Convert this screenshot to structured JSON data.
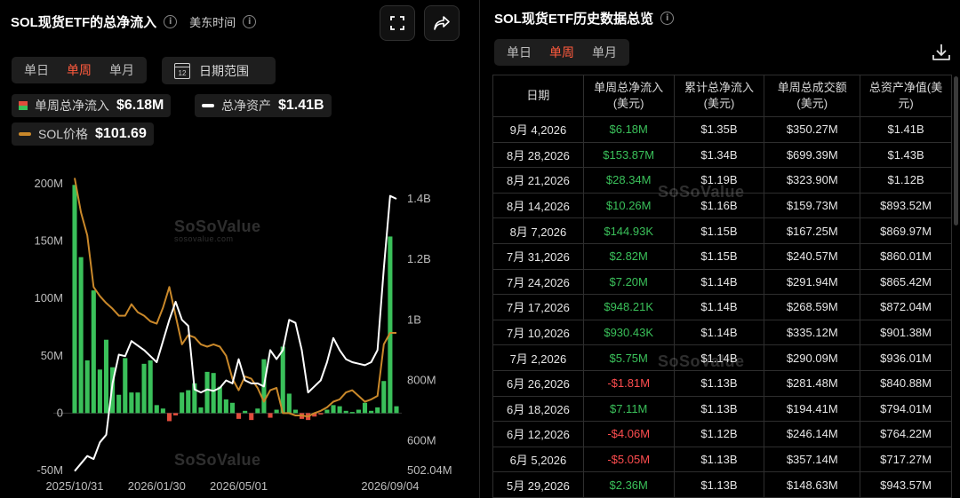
{
  "left": {
    "title": "SOL现货ETF的总净流入",
    "timezone": "美东时间",
    "period_tabs": [
      "单日",
      "单周",
      "单月"
    ],
    "active_tab": "单周",
    "date_range_label": "日期范围",
    "calendar_day": "12",
    "stats": {
      "net_inflow_label": "单周总净流入",
      "net_inflow_value": "$6.18M",
      "total_assets_label": "总净资产",
      "total_assets_value": "$1.41B",
      "price_label": "SOL价格",
      "price_value": "$101.69"
    },
    "watermark": "SoSoValue",
    "watermark_sub": "sosovalue.com"
  },
  "colors": {
    "inflow": "#3ac05a",
    "outflow": "#e04c3c",
    "net_assets_line": "#ffffff",
    "price_line": "#c9882a",
    "accent": "#ff5a3d"
  },
  "chart_data": {
    "type": "bar",
    "x_ticks": [
      "2025/10/31",
      "2026/01/30",
      "2026/05/01",
      "2026/09/04"
    ],
    "y_left_ticks": [
      "200M",
      "150M",
      "100M",
      "50M",
      "0",
      "-50M"
    ],
    "y_right_ticks": [
      "1.4B",
      "1.2B",
      "1B",
      "800M",
      "600M",
      "502.04M"
    ],
    "ylim_left": [
      -50,
      200
    ],
    "ylim_right": [
      502.04,
      1450
    ],
    "series": [
      {
        "name": "单周总净流入",
        "unit": "M",
        "values": [
          199,
          136,
          46,
          107,
          38,
          64,
          40,
          16,
          48,
          18,
          18,
          43,
          46,
          7,
          4,
          -7,
          -2,
          18,
          20,
          26,
          5,
          36,
          35,
          23,
          12,
          9,
          -5,
          2,
          -6,
          4,
          47,
          -4,
          3,
          58,
          17,
          3,
          -5,
          -6,
          -3,
          -1,
          3,
          7,
          6,
          2,
          1,
          3,
          9,
          2,
          5,
          28,
          154,
          6
        ]
      },
      {
        "name": "总净资产",
        "unit": "M",
        "values": [
          500,
          525,
          550,
          540,
          595,
          620,
          790,
          885,
          880,
          930,
          915,
          900,
          880,
          860,
          930,
          1000,
          1060,
          1000,
          980,
          770,
          760,
          770,
          765,
          775,
          800,
          790,
          870,
          800,
          790,
          790,
          780,
          900,
          870,
          900,
          1000,
          990,
          900,
          760,
          780,
          800,
          860,
          940,
          900,
          870,
          860,
          855,
          850,
          860,
          900,
          1170,
          1410,
          1400
        ]
      },
      {
        "name": "SOL价格",
        "unit": "USD",
        "values": [
          205,
          175,
          155,
          110,
          102,
          96,
          91,
          85,
          85,
          95,
          88,
          85,
          80,
          78,
          92,
          110,
          85,
          60,
          68,
          66,
          60,
          58,
          60,
          58,
          50,
          30,
          20,
          32,
          30,
          22,
          10,
          20,
          22,
          0,
          0,
          -2,
          -2,
          -3,
          0,
          2,
          5,
          10,
          12,
          18,
          20,
          15,
          10,
          12,
          15,
          60,
          70,
          70
        ]
      }
    ]
  },
  "right": {
    "title": "SOL现货ETF历史数据总览",
    "period_tabs": [
      "单日",
      "单周",
      "单月"
    ],
    "active_tab": "单周",
    "headers": [
      [
        "日期",
        ""
      ],
      [
        "单周总净流入",
        "(美元)"
      ],
      [
        "累计总净流入",
        "(美元)"
      ],
      [
        "单周总成交额",
        "(美元)"
      ],
      [
        "总资产净值(美",
        "元)"
      ]
    ],
    "rows": [
      {
        "date": "9月 4,2026",
        "flow": "$6.18M",
        "sign": "pos",
        "cum": "$1.35B",
        "vol": "$350.27M",
        "nav": "$1.41B"
      },
      {
        "date": "8月 28,2026",
        "flow": "$153.87M",
        "sign": "pos",
        "cum": "$1.34B",
        "vol": "$699.39M",
        "nav": "$1.43B"
      },
      {
        "date": "8月 21,2026",
        "flow": "$28.34M",
        "sign": "pos",
        "cum": "$1.19B",
        "vol": "$323.90M",
        "nav": "$1.12B"
      },
      {
        "date": "8月 14,2026",
        "flow": "$10.26M",
        "sign": "pos",
        "cum": "$1.16B",
        "vol": "$159.73M",
        "nav": "$893.52M"
      },
      {
        "date": "8月 7,2026",
        "flow": "$144.93K",
        "sign": "pos",
        "cum": "$1.15B",
        "vol": "$167.25M",
        "nav": "$869.97M"
      },
      {
        "date": "7月 31,2026",
        "flow": "$2.82M",
        "sign": "pos",
        "cum": "$1.15B",
        "vol": "$240.57M",
        "nav": "$860.01M"
      },
      {
        "date": "7月 24,2026",
        "flow": "$7.20M",
        "sign": "pos",
        "cum": "$1.14B",
        "vol": "$291.94M",
        "nav": "$865.42M"
      },
      {
        "date": "7月 17,2026",
        "flow": "$948.21K",
        "sign": "pos",
        "cum": "$1.14B",
        "vol": "$268.59M",
        "nav": "$872.04M"
      },
      {
        "date": "7月 10,2026",
        "flow": "$930.43K",
        "sign": "pos",
        "cum": "$1.14B",
        "vol": "$335.12M",
        "nav": "$901.38M"
      },
      {
        "date": "7月 2,2026",
        "flow": "$5.75M",
        "sign": "pos",
        "cum": "$1.14B",
        "vol": "$290.09M",
        "nav": "$936.01M"
      },
      {
        "date": "6月 26,2026",
        "flow": "-$1.81M",
        "sign": "neg",
        "cum": "$1.13B",
        "vol": "$281.48M",
        "nav": "$840.88M"
      },
      {
        "date": "6月 18,2026",
        "flow": "$7.11M",
        "sign": "pos",
        "cum": "$1.13B",
        "vol": "$194.41M",
        "nav": "$794.01M"
      },
      {
        "date": "6月 12,2026",
        "flow": "-$4.06M",
        "sign": "neg",
        "cum": "$1.12B",
        "vol": "$246.14M",
        "nav": "$764.22M"
      },
      {
        "date": "6月 5,2026",
        "flow": "-$5.05M",
        "sign": "neg",
        "cum": "$1.13B",
        "vol": "$357.14M",
        "nav": "$717.27M"
      },
      {
        "date": "5月 29,2026",
        "flow": "$2.36M",
        "sign": "pos",
        "cum": "$1.13B",
        "vol": "$148.63M",
        "nav": "$943.57M"
      }
    ]
  }
}
